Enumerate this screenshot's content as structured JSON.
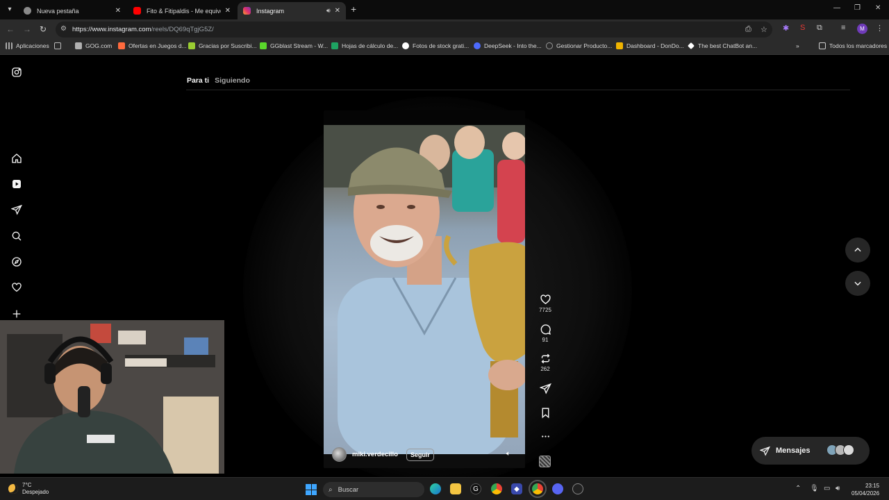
{
  "browser": {
    "tabs": [
      {
        "title": "Nueva pestaña",
        "favicon_color": "#8a8a8a",
        "active": false
      },
      {
        "title": "Fito & Fitipaldis - Me equivocar",
        "favicon_color": "#ff0000",
        "active": false
      },
      {
        "title": "Instagram",
        "favicon_color": "#e1306c",
        "active": true
      }
    ],
    "url_host": "https://www.instagram.com",
    "url_path": "/reels/DQ69qTgjG5Z/"
  },
  "bookmarks": [
    {
      "label": "Aplicaciones",
      "color": "#7a7a7a"
    },
    {
      "label": "GOG.com",
      "color": "#b0b0b0"
    },
    {
      "label": "Ofertas en Juegos d...",
      "color": "#ff6a3d"
    },
    {
      "label": "Gracias por Suscribi...",
      "color": "#9acd32"
    },
    {
      "label": "GGblast Stream - W...",
      "color": "#5ad82b"
    },
    {
      "label": "Hojas de cálculo de...",
      "color": "#1ea362"
    },
    {
      "label": "Fotos de stock grati...",
      "color": "#ffffff"
    },
    {
      "label": "DeepSeek - Into the...",
      "color": "#4d6bfe"
    },
    {
      "label": "Gestionar Producto...",
      "color": "#777777"
    },
    {
      "label": "Dashboard - DonDo...",
      "color": "#f0b400"
    },
    {
      "label": "The best ChatBot an...",
      "color": "#ffffff"
    },
    {
      "label": "Todos los marcadores",
      "color": "#cfcfcf"
    }
  ],
  "feed": {
    "tab_for_you": "Para ti",
    "tab_following": "Siguiendo"
  },
  "reel": {
    "username": "miki.verdecillo",
    "follow_label": "Seguir",
    "likes": "7725",
    "comments": "91",
    "reposts": "262"
  },
  "messages": {
    "label": "Mensajes",
    "avatar_colors": [
      "#7fa3b8",
      "#b7b7b7",
      "#d9d9d9"
    ]
  },
  "taskbar": {
    "temperature": "7°C",
    "weather": "Despejado",
    "search_placeholder": "Buscar",
    "time": "23:15",
    "date": "05/04/2026"
  }
}
